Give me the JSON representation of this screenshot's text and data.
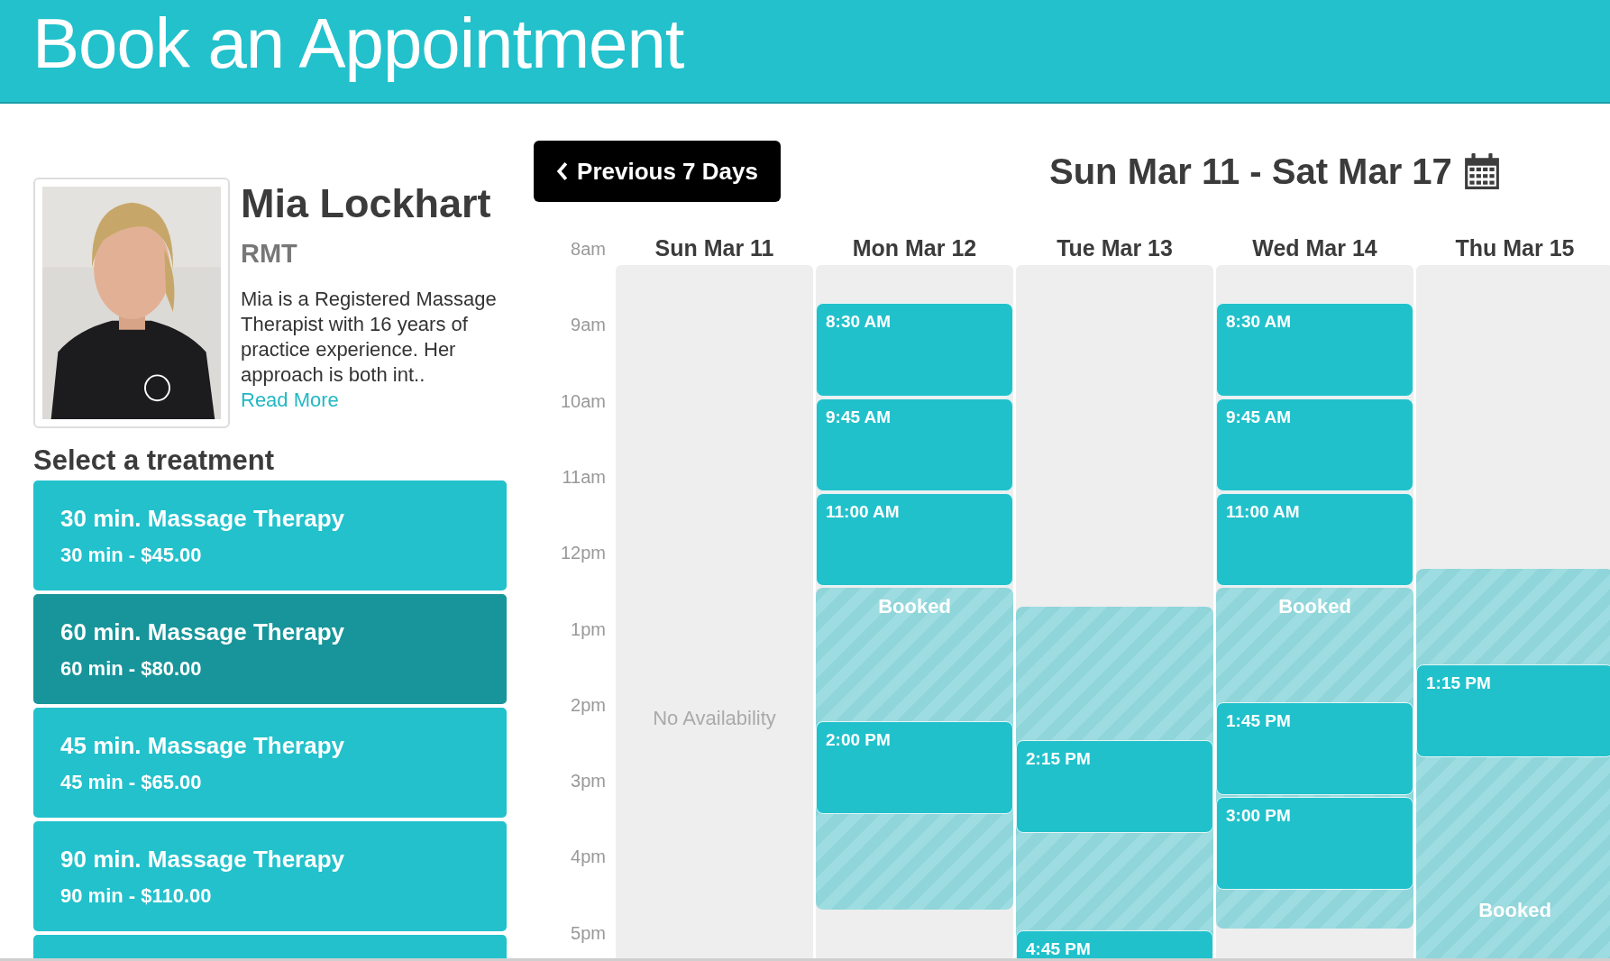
{
  "header": {
    "title": "Book an Appointment"
  },
  "therapist": {
    "name": "Mia Lockhart",
    "title": "RMT",
    "bio": "Mia is a Registered Massage Therapist with 16 years of practice experience. Her approach is both int..",
    "read_more": "Read More"
  },
  "treatments": {
    "heading": "Select a treatment",
    "items": [
      {
        "name": "30 min. Massage Therapy",
        "detail": "30 min - $45.00",
        "selected": false
      },
      {
        "name": "60 min. Massage Therapy",
        "detail": "60 min - $80.00",
        "selected": true
      },
      {
        "name": "45 min. Massage Therapy",
        "detail": "45 min - $65.00",
        "selected": false
      },
      {
        "name": "90 min. Massage Therapy",
        "detail": "90 min - $110.00",
        "selected": false
      },
      {
        "selected": false
      }
    ]
  },
  "calendar": {
    "previous_button": "Previous 7 Days",
    "range": "Sun Mar 11 - Sat Mar 17",
    "hours": [
      "8am",
      "9am",
      "10am",
      "11am",
      "12pm",
      "1pm",
      "2pm",
      "3pm",
      "4pm",
      "5pm"
    ],
    "days": [
      {
        "label": "Sun Mar 11",
        "note": "No Availability"
      },
      {
        "label": "Mon Mar 12",
        "rows": [
          {
            "kind": "free"
          },
          {
            "kind": "free"
          },
          {
            "kind": "free"
          },
          {
            "kind": "free"
          },
          {
            "kind": "free"
          },
          {
            "kind": "free"
          },
          {
            "kind": "free"
          },
          {
            "kind": "free"
          },
          {
            "kind": "free"
          },
          {
            "kind": "free"
          },
          {
            "kind": "free"
          },
          {
            "kind": "free"
          },
          {
            "kind": "free"
          },
          {
            "kind": "free"
          },
          {
            "kind": "free"
          },
          {
            "kind": "free"
          },
          {
            "kind": "free"
          },
          {
            "kind": "booked",
            "label": "Booked"
          },
          {
            "kind": "booked"
          },
          {
            "kind": "booked"
          },
          {
            "kind": "booked"
          },
          {
            "kind": "booked"
          },
          {
            "kind": "booked"
          },
          {
            "kind": "booked"
          },
          {
            "kind": "booked"
          },
          {
            "kind": "booked"
          },
          {
            "kind": "booked"
          },
          {
            "kind": "booked"
          },
          {
            "kind": "booked"
          },
          {
            "kind": "booked"
          },
          {
            "kind": "booked"
          },
          {
            "kind": "booked"
          },
          {
            "kind": "booked"
          },
          {
            "kind": "booked"
          },
          {
            "kind": "free"
          },
          {
            "kind": "free"
          },
          {
            "kind": "free"
          }
        ],
        "slots": [
          {
            "label": "8:30 AM"
          },
          {
            "label": "9:45 AM"
          },
          {
            "label": "11:00 AM"
          },
          {
            "label": "2:00 PM"
          }
        ]
      },
      {
        "label": "Tue Mar 13",
        "rows": [
          {
            "kind": "free"
          },
          {
            "kind": "free"
          },
          {
            "kind": "free"
          },
          {
            "kind": "free"
          },
          {
            "kind": "free"
          },
          {
            "kind": "free"
          },
          {
            "kind": "free"
          },
          {
            "kind": "free"
          },
          {
            "kind": "free"
          },
          {
            "kind": "free"
          },
          {
            "kind": "free"
          },
          {
            "kind": "free"
          },
          {
            "kind": "free"
          },
          {
            "kind": "free"
          },
          {
            "kind": "free"
          },
          {
            "kind": "free"
          },
          {
            "kind": "free"
          },
          {
            "kind": "free"
          },
          {
            "kind": "booked"
          },
          {
            "kind": "booked"
          },
          {
            "kind": "booked"
          },
          {
            "kind": "booked"
          },
          {
            "kind": "booked"
          },
          {
            "kind": "booked"
          },
          {
            "kind": "booked"
          },
          {
            "kind": "booked"
          },
          {
            "kind": "booked"
          },
          {
            "kind": "booked"
          },
          {
            "kind": "booked"
          },
          {
            "kind": "booked"
          },
          {
            "kind": "booked"
          },
          {
            "kind": "booked"
          },
          {
            "kind": "booked"
          },
          {
            "kind": "booked"
          },
          {
            "kind": "booked"
          },
          {
            "kind": "booked"
          },
          {
            "kind": "booked"
          }
        ],
        "slots": [
          {
            "label": "2:15 PM"
          },
          {
            "label": "4:45 PM"
          }
        ]
      },
      {
        "label": "Wed Mar 14",
        "rows": [
          {
            "kind": "free"
          },
          {
            "kind": "free"
          },
          {
            "kind": "free"
          },
          {
            "kind": "free"
          },
          {
            "kind": "free"
          },
          {
            "kind": "free"
          },
          {
            "kind": "free"
          },
          {
            "kind": "free"
          },
          {
            "kind": "free"
          },
          {
            "kind": "free"
          },
          {
            "kind": "free"
          },
          {
            "kind": "free"
          },
          {
            "kind": "free"
          },
          {
            "kind": "free"
          },
          {
            "kind": "free"
          },
          {
            "kind": "free"
          },
          {
            "kind": "free"
          },
          {
            "kind": "booked",
            "label": "Booked"
          },
          {
            "kind": "booked"
          },
          {
            "kind": "booked"
          },
          {
            "kind": "booked"
          },
          {
            "kind": "booked"
          },
          {
            "kind": "booked"
          },
          {
            "kind": "booked"
          },
          {
            "kind": "booked"
          },
          {
            "kind": "booked"
          },
          {
            "kind": "booked"
          },
          {
            "kind": "booked"
          },
          {
            "kind": "booked"
          },
          {
            "kind": "booked"
          },
          {
            "kind": "booked"
          },
          {
            "kind": "booked"
          },
          {
            "kind": "booked"
          },
          {
            "kind": "booked"
          },
          {
            "kind": "booked"
          },
          {
            "kind": "free"
          }
        ],
        "slots": [
          {
            "label": "8:30 AM"
          },
          {
            "label": "9:45 AM"
          },
          {
            "label": "11:00 AM"
          },
          {
            "label": "1:45 PM"
          },
          {
            "label": "3:00 PM"
          }
        ]
      },
      {
        "label": "Thu Mar 15",
        "rows": [
          {
            "kind": "free"
          },
          {
            "kind": "free"
          },
          {
            "kind": "free"
          },
          {
            "kind": "free"
          },
          {
            "kind": "free"
          },
          {
            "kind": "free"
          },
          {
            "kind": "free"
          },
          {
            "kind": "free"
          },
          {
            "kind": "free"
          },
          {
            "kind": "free"
          },
          {
            "kind": "free"
          },
          {
            "kind": "free"
          },
          {
            "kind": "free"
          },
          {
            "kind": "free"
          },
          {
            "kind": "free"
          },
          {
            "kind": "free"
          },
          {
            "kind": "booked"
          },
          {
            "kind": "booked"
          },
          {
            "kind": "booked"
          },
          {
            "kind": "booked"
          },
          {
            "kind": "booked"
          },
          {
            "kind": "booked"
          },
          {
            "kind": "booked"
          },
          {
            "kind": "booked"
          },
          {
            "kind": "booked"
          },
          {
            "kind": "booked"
          },
          {
            "kind": "booked"
          },
          {
            "kind": "booked"
          },
          {
            "kind": "booked"
          },
          {
            "kind": "booked"
          },
          {
            "kind": "booked"
          },
          {
            "kind": "booked"
          },
          {
            "kind": "booked"
          },
          {
            "kind": "booked",
            "label": "Booked"
          },
          {
            "kind": "booked"
          },
          {
            "kind": "booked"
          },
          {
            "kind": "booked"
          }
        ],
        "slots": [
          {
            "label": "1:15 PM"
          }
        ]
      }
    ]
  }
}
